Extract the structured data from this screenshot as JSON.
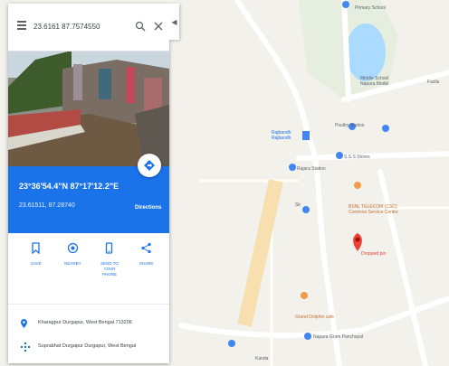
{
  "search": {
    "query": "23.6161 87.7574550"
  },
  "place": {
    "coords": "23°36'54.4\"N 87°17'12.2\"E",
    "plus_code": "23.61511, 87.28740",
    "directions_label": "Directions"
  },
  "actions": [
    {
      "label": "Save",
      "icon": "bookmark-icon"
    },
    {
      "label": "Nearby",
      "icon": "nearby-icon"
    },
    {
      "label": "Send to your phone",
      "icon": "phone-icon"
    },
    {
      "label": "Share",
      "icon": "share-icon"
    }
  ],
  "info": [
    {
      "text": "Kharagpur Durgapur, West Bengal 713206",
      "icon": "location-pin-icon"
    },
    {
      "text": "Suprabhat Durgapur Durgapur, West Bengal",
      "icon": "plus-code-icon"
    }
  ],
  "map": {
    "labels": {
      "top_school": "Primary School",
      "middle_school": "Middle School\nNapara Model",
      "rajbandh": "Rajbandh\nRajbandh",
      "fazila": "Fazila",
      "sss_stores": "S.S.S Stores",
      "poultry": "Poultry Station",
      "rajara": "Rajara Station",
      "sk": "Sk",
      "bsnl": "BSNL TELECOM (CSC)\nCommon Service Centre",
      "pin_label": "Dropped pin",
      "cafe": "Grand Dolphin cafe",
      "gram": "Napara Gram Panchayat",
      "kanda": "Kanda"
    }
  },
  "colors": {
    "accent": "#1a73e8",
    "pin": "#ea4335",
    "water": "#aadaff",
    "park": "#c8e6b5"
  }
}
